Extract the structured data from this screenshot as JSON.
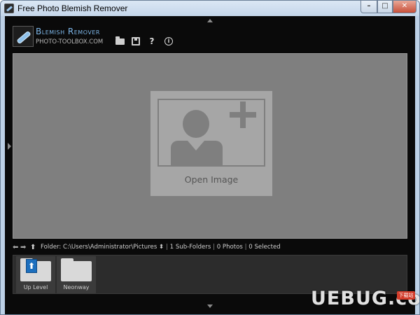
{
  "window": {
    "title": "Free Photo Blemish Remover",
    "controls": {
      "minimize": "–",
      "maximize": "□",
      "close": "✕"
    }
  },
  "logo": {
    "title": "Blemish Remover",
    "subtitle": "PHOTO-TOOLBOX.COM",
    "icon": "bandage-icon"
  },
  "toolbar": {
    "open_icon": "folder-open-icon",
    "save_icon": "save-icon",
    "help_label": "?",
    "info_label": "i"
  },
  "canvas": {
    "open_image_label": "Open Image",
    "placeholder_icon": "add-person-icon"
  },
  "navigation": {
    "back": "⬅",
    "forward": "➡",
    "up": "⬆",
    "folder_label": "Folder:",
    "folder_path": "C:\\Users\\Administrator\\Pictures",
    "path_toggle": "⬍",
    "subfolders": "1 Sub-Folders",
    "photos": "0 Photos",
    "selected": "0 Selected",
    "separator": "|"
  },
  "browser": {
    "items": [
      {
        "label": "Up Level",
        "icon": "folder-up-icon"
      },
      {
        "label": "Neonway",
        "icon": "folder-icon"
      }
    ]
  },
  "watermark": {
    "text": "UEBUG.com",
    "tag": "下载站"
  },
  "colors": {
    "logo_accent": "#7fb8ea",
    "canvas_bg": "#7f7f7f",
    "up_level_badge": "#1c6fbe"
  }
}
